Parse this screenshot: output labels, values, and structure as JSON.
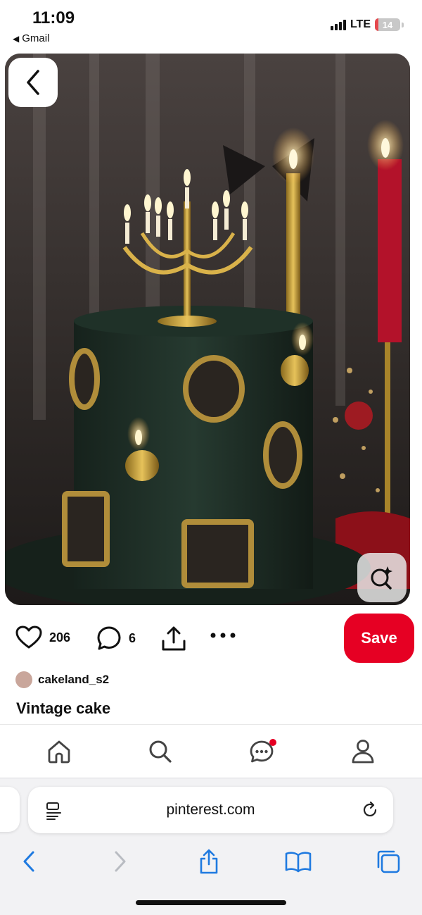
{
  "status_bar": {
    "time": "11:09",
    "back_app": "Gmail",
    "network": "LTE",
    "battery": "14",
    "battery_level": 0.14,
    "battery_color": "#e5484d"
  },
  "pin": {
    "likes": "206",
    "comments": "6",
    "save_label": "Save",
    "save_color": "#e60023",
    "creator": "cakeland_s2",
    "title": "Vintage cake"
  },
  "icons": {
    "back": "chevron-left-icon",
    "visual_search": "lens-search-icon",
    "like": "heart-icon",
    "comment": "comment-icon",
    "share": "share-icon",
    "more": "more-icon",
    "nav": [
      "home-icon",
      "search-icon",
      "messages-icon",
      "profile-icon"
    ]
  },
  "nav": {
    "messages_badge_color": "#e60023"
  },
  "browser": {
    "url": "pinterest.com",
    "accent": "#1f7ae0"
  }
}
